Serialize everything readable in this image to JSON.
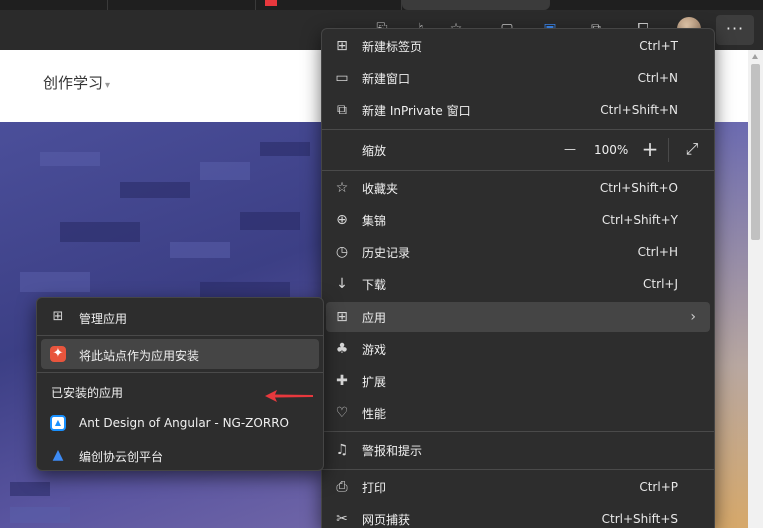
{
  "page": {
    "nav_label": "创作学习",
    "nav_caret": "▾"
  },
  "toolbar": {
    "more_label": "···"
  },
  "main_menu": {
    "items": [
      {
        "label": "新建标签页",
        "shortcut": "Ctrl+T",
        "icon": "new-tab-icon"
      },
      {
        "label": "新建窗口",
        "shortcut": "Ctrl+N",
        "icon": "new-window-icon"
      },
      {
        "label": "新建 InPrivate 窗口",
        "shortcut": "Ctrl+Shift+N",
        "icon": "inprivate-icon"
      },
      {
        "label": "缩放",
        "icon": "zoom-icon"
      },
      {
        "label": "收藏夹",
        "shortcut": "Ctrl+Shift+O",
        "icon": "favorites-icon"
      },
      {
        "label": "集锦",
        "shortcut": "Ctrl+Shift+Y",
        "icon": "collections-icon"
      },
      {
        "label": "历史记录",
        "shortcut": "Ctrl+H",
        "icon": "history-icon"
      },
      {
        "label": "下载",
        "shortcut": "Ctrl+J",
        "icon": "download-icon"
      },
      {
        "label": "应用",
        "icon": "apps-icon"
      },
      {
        "label": "游戏",
        "icon": "games-icon"
      },
      {
        "label": "扩展",
        "icon": "extensions-icon"
      },
      {
        "label": "性能",
        "icon": "performance-icon"
      },
      {
        "label": "警报和提示",
        "icon": "alerts-icon"
      },
      {
        "label": "打印",
        "shortcut": "Ctrl+P",
        "icon": "print-icon"
      },
      {
        "label": "网页捕获",
        "shortcut": "Ctrl+Shift+S",
        "icon": "web-capture-icon"
      }
    ],
    "zoom": {
      "minus": "—",
      "value": "100%",
      "plus": "+"
    },
    "submenu_arrow": "›"
  },
  "apps_submenu": {
    "manage_label": "管理应用",
    "install_label": "将此站点作为应用安装",
    "installed_heading": "已安装的应用",
    "installed_apps": [
      {
        "label": "Ant Design of Angular - NG-ZORRO",
        "color": "#1890ff"
      },
      {
        "label": "编创协云创平台",
        "color": "#2f7cf6"
      }
    ]
  },
  "colors": {
    "menu_bg": "#2d2d2d",
    "highlight": "#454545",
    "arrow_red": "#e8383d"
  }
}
